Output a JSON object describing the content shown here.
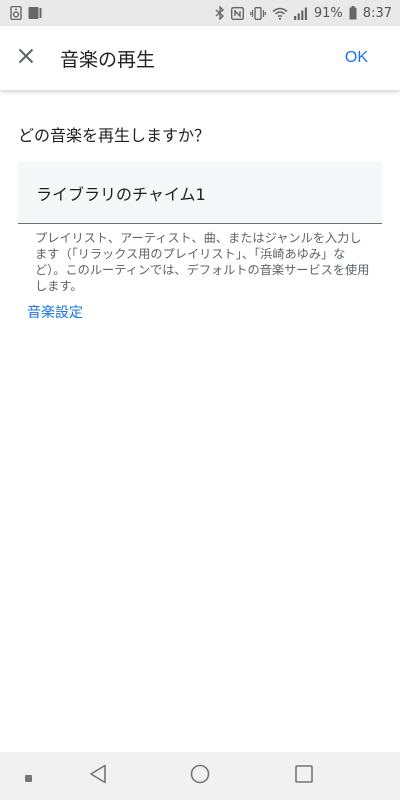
{
  "status_bar": {
    "battery_percent": "91%",
    "time": "8:37",
    "icon_color": "#666666"
  },
  "app_bar": {
    "title": "音楽の再生",
    "ok_label": "OK",
    "accent_color": "#1a73e8"
  },
  "main": {
    "question": "どの音楽を再生しますか？",
    "input_value": "ライブラリのチャイム1",
    "helper_text": "プレイリスト、アーティスト、曲、またはジャンルを入力します（「リラックス用のプレイリスト」、「浜崎あゆみ」など）。このルーティンでは、デフォルトの音楽サービスを使用します。",
    "settings_link": "音楽設定"
  },
  "nav_bar": {
    "icons": [
      "dot-icon",
      "back-icon",
      "home-icon",
      "recents-icon"
    ]
  }
}
